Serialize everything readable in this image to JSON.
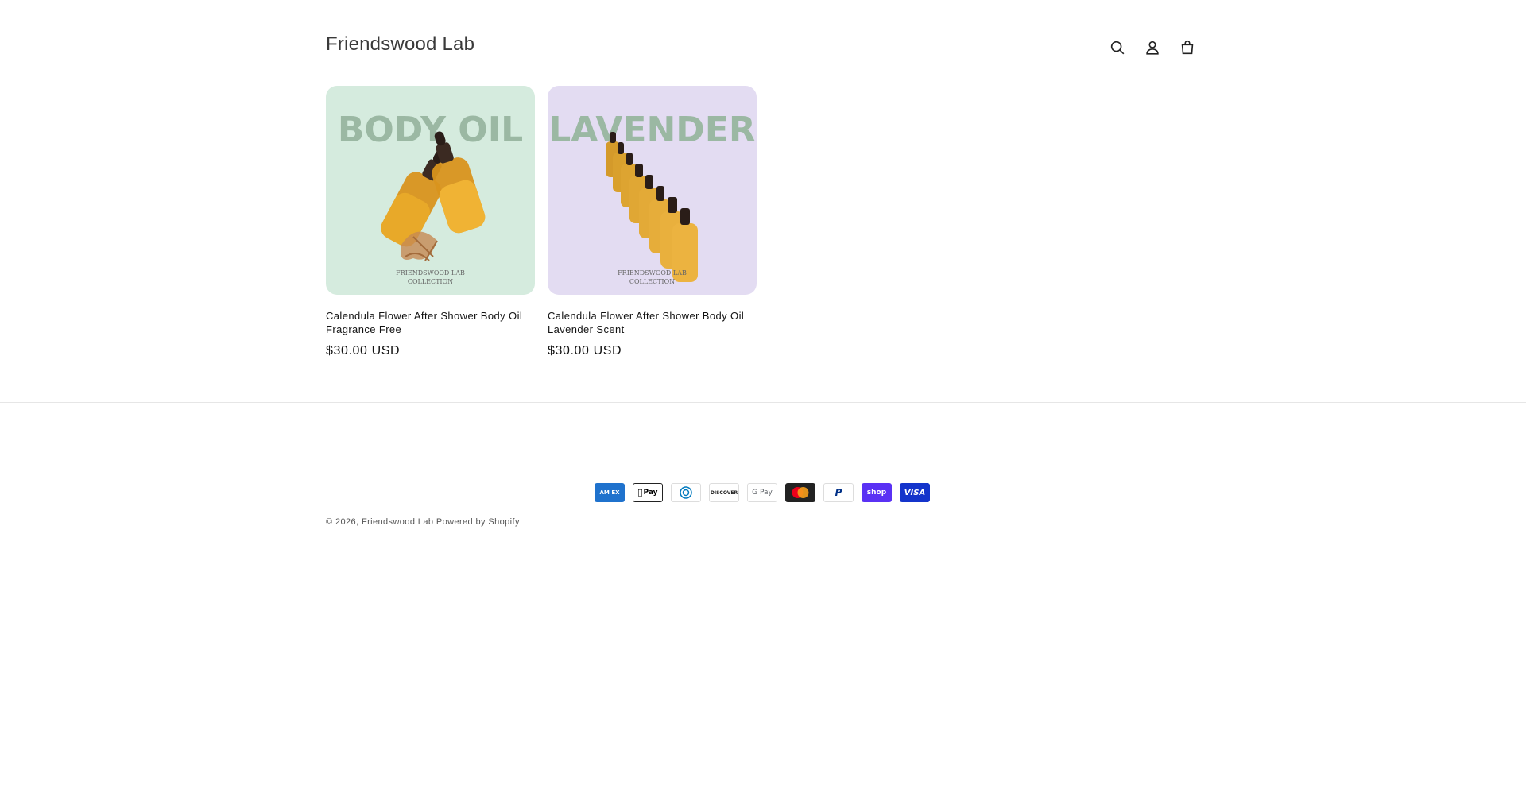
{
  "header": {
    "store_name": "Friendswood Lab",
    "icons": [
      "search-icon",
      "account-icon",
      "cart-icon"
    ]
  },
  "products": [
    {
      "title": "Calendula Flower After Shower Body Oil Fragrance Free",
      "price": "$30.00 USD",
      "image_heading": "BODY OIL",
      "image_caption_1": "FRIENDSWOOD LAB",
      "image_caption_2": "COLLECTION",
      "image_bg": "#d5ebde"
    },
    {
      "title": "Calendula Flower After Shower Body Oil Lavender Scent",
      "price": "$30.00 USD",
      "image_heading": "LAVENDER",
      "image_caption_1": "FRIENDSWOOD LAB",
      "image_caption_2": "COLLECTION",
      "image_bg": "#e3dcf2"
    }
  ],
  "footer": {
    "payment_methods": [
      "American Express",
      "Apple Pay",
      "Diners Club",
      "Discover",
      "Google Pay",
      "Mastercard",
      "PayPal",
      "Shop Pay",
      "Visa"
    ],
    "payment_labels": {
      "amex": "AM EX",
      "applepay": "Pay",
      "discover": "DISCOVER",
      "gpay": "G Pay",
      "paypal": "P",
      "shoppay": "shop",
      "visa": "VISA"
    },
    "copyright_prefix": "© 2026,",
    "store_link": "Friendswood Lab",
    "powered_by": "Powered by Shopify"
  }
}
